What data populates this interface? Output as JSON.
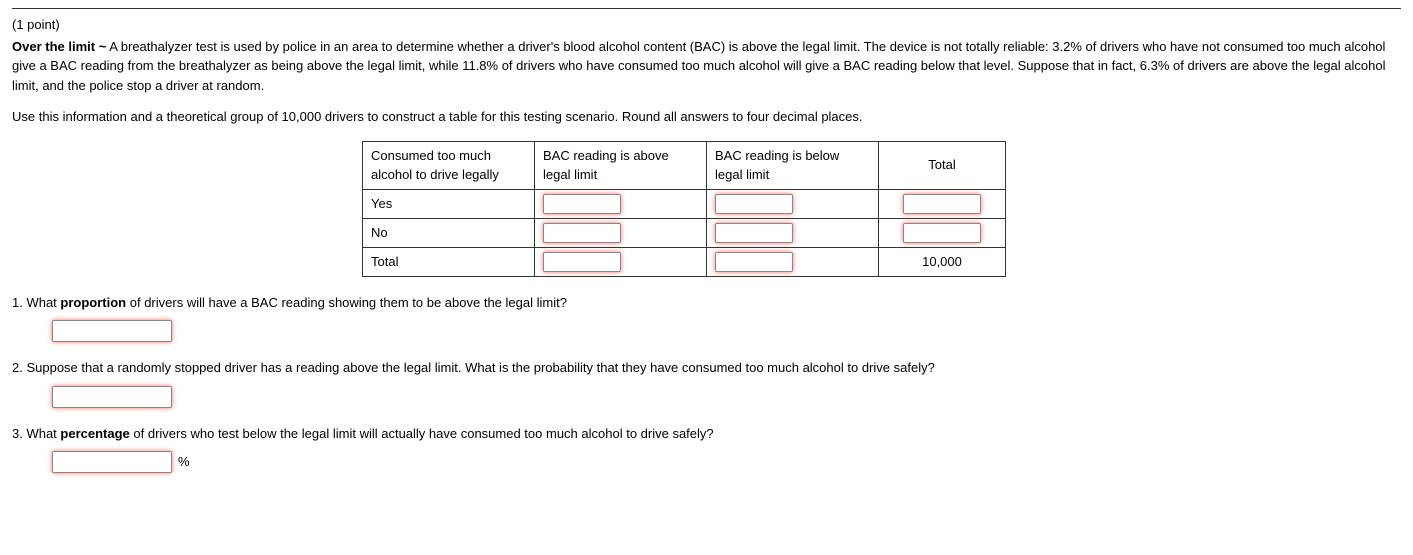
{
  "points": "(1 point)",
  "title_bold": "Over the limit ~",
  "intro_line1": "A breathalyzer test is used by police in an area to determine whether a driver's blood alcohol content (BAC) is above the legal limit. The device is not totally reliable: 3.2% of drivers who have not consumed too much alcohol give a BAC reading from the breathalyzer as being above the legal limit, while 11.8% of drivers who have consumed too much alcohol will give a BAC reading below that level. Suppose that in fact, 6.3% of drivers are above the legal alcohol limit, and the police stop a driver at random.",
  "intro_line2": "Use this information and a theoretical group of 10,000 drivers to construct a table for this testing scenario. Round all answers to four decimal places.",
  "table": {
    "head_col1": "Consumed too much alcohol to drive legally",
    "head_col2": "BAC reading is above legal limit",
    "head_col3": "BAC reading is below legal limit",
    "head_col4": "Total",
    "row1_label": "Yes",
    "row2_label": "No",
    "row3_label": "Total",
    "grand_total": "10,000"
  },
  "q1_prefix": "1. What ",
  "q1_bold": "proportion",
  "q1_suffix": " of drivers will have a BAC reading showing them to be above the legal limit?",
  "q2": "2. Suppose that a randomly stopped driver has a reading above the legal limit. What is the probability that they have consumed too much alcohol to drive safely?",
  "q3_prefix": "3. What ",
  "q3_bold": "percentage",
  "q3_suffix": " of drivers who test below the legal limit will actually have consumed too much alcohol to drive safely?",
  "pct_symbol": "%"
}
